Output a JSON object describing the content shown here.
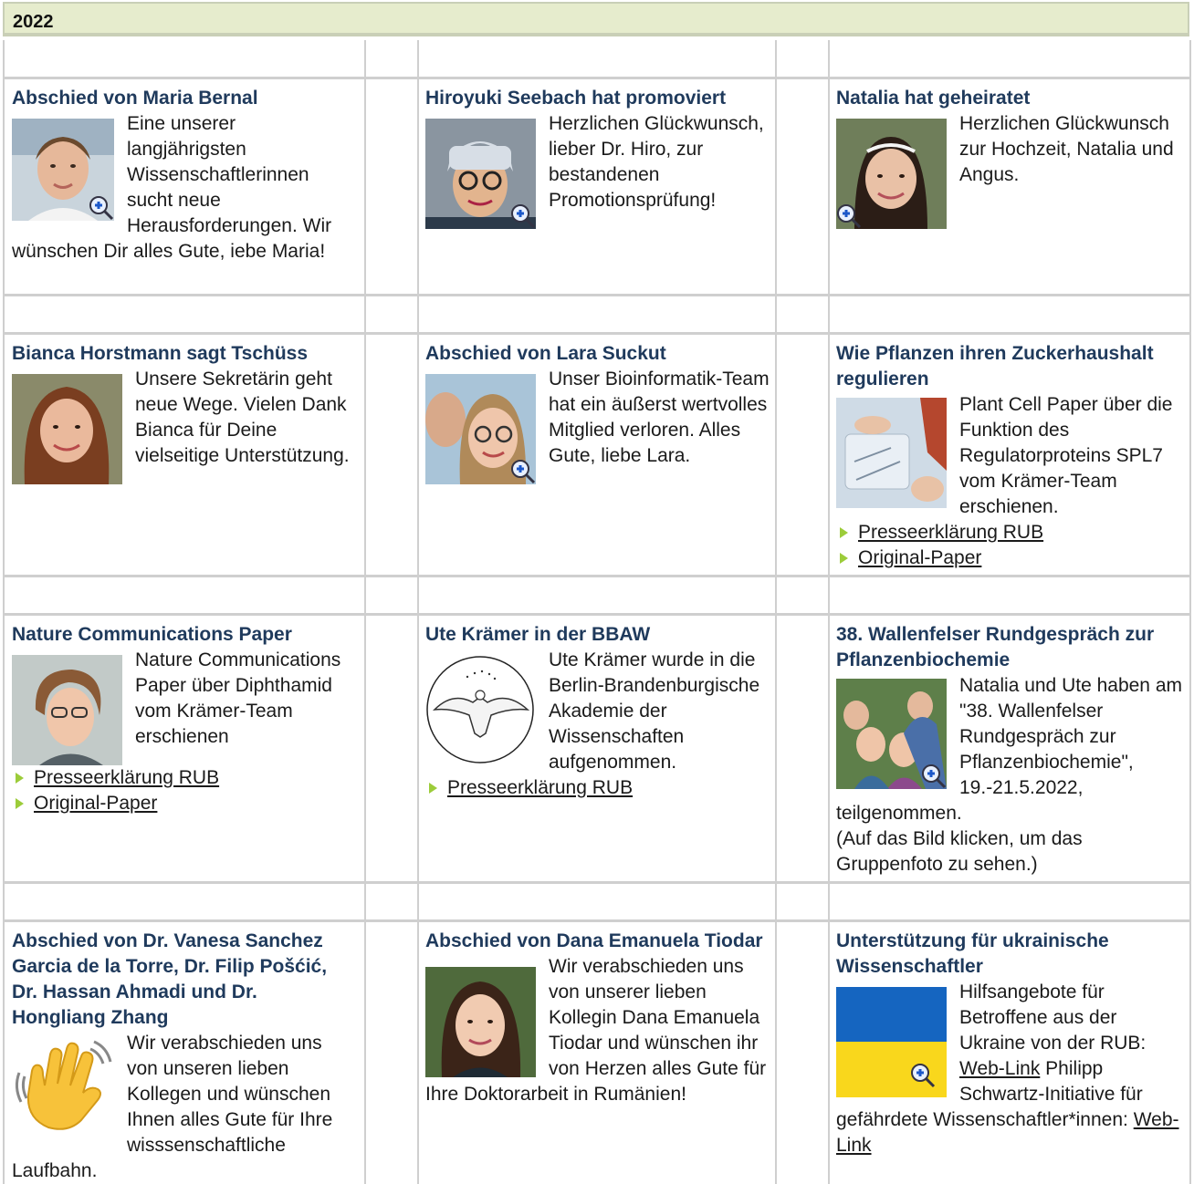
{
  "year": "2022",
  "news": [
    {
      "title": "Abschied von Maria Bernal",
      "text": "Eine unserer langjährigsten Wissenschaftlerinnen sucht neue Herausforderungen. Wir wünschen Dir alles Gute, iebe Maria!",
      "image": "portrait-woman-icon",
      "zoomable": true
    },
    {
      "title": "Hiroyuki Seebach hat promoviert",
      "text": "Herzlichen Glückwunsch, lieber Dr. Hiro, zur bestandenen Promotionsprüfung!",
      "image": "portrait-man-hat-icon",
      "zoomable": true
    },
    {
      "title": "Natalia hat geheiratet",
      "text": "Herzlichen Glückwunsch zur Hochzeit, Natalia und Angus.",
      "image": "portrait-bride-icon",
      "zoomable": true
    },
    {
      "title": "Bianca Horstmann sagt Tschüss",
      "text": "Unsere Sekretärin geht neue Wege. Vielen Dank Bianca für Deine vielseitige Unterstützung.",
      "image": "portrait-woman-icon",
      "zoomable": false
    },
    {
      "title": "Abschied von Lara Suckut",
      "text": "Unser Bioinformatik-Team hat ein äußerst wertvolles Mitglied verloren. Alles Gute, liebe Lara.",
      "image": "portrait-couple-icon",
      "zoomable": true
    },
    {
      "title": "Wie Pflanzen ihren Zuckerhaushalt regulieren",
      "text": "Plant Cell Paper über die Funktion des Regulatorproteins SPL7 vom Krämer-Team erschienen.",
      "image": "lab-photo-icon",
      "zoomable": false,
      "links": [
        "Presseerklärung RUB",
        "Original-Paper"
      ]
    },
    {
      "title": "Nature Communications Paper",
      "text": "Nature Communications Paper über Diphthamid vom Krämer-Team erschienen",
      "image": "portrait-woman-icon",
      "zoomable": false,
      "links": [
        "Presseerklärung RUB",
        "Original-Paper"
      ]
    },
    {
      "title": "Ute Krämer in der BBAW",
      "text": "Ute Krämer wurde in die Berlin-Brandenburgische Akademie der Wissenschaften aufgenommen.",
      "image": "eagle-seal-icon",
      "zoomable": false,
      "links": [
        "Presseerklärung RUB"
      ]
    },
    {
      "title": "38. Wallenfelser Rundgespräch zur Pflanzenbiochemie",
      "text": "Natalia und Ute haben am \"38. Wallenfelser Rundgespräch zur Pflanzenbiochemie\", 19.-21.5.2022, teilgenommen.",
      "note": "(Auf das Bild klicken, um das Gruppenfoto zu sehen.)",
      "image": "group-photo-icon",
      "zoomable": true
    },
    {
      "title": "Abschied von Dr. Vanesa Sanchez Garcia de la Torre, Dr. Filip Pošćić, Dr. Hassan Ahmadi und Dr. Hongliang Zhang",
      "text": "Wir verabschieden uns von unseren lieben Kollegen und wünschen Ihnen alles Gute für Ihre wisssenschaftliche Laufbahn.",
      "image": "waving-hand-icon",
      "zoomable": false
    },
    {
      "title": "Abschied von Dana Emanuela Tiodar",
      "text": "Wir verabschieden uns von unserer lieben Kollegin Dana Emanuela Tiodar und wünschen ihr von Herzen alles Gute für Ihre Doktorarbeit in Rumänien!",
      "image": "portrait-woman-icon",
      "zoomable": false
    },
    {
      "title": "Unterstützung für ukrainische Wissenschaftler",
      "text1": "Hilfsangebote für Betroffene aus der Ukraine von der RUB:",
      "link1": "Web-Link",
      "text2": "Philipp Schwartz-Initiative für gefährdete Wissenschaftler*innen:",
      "link2": "Web-Link",
      "image": "ukraine-flag-icon",
      "zoomable": true
    }
  ],
  "colors": {
    "header_bg": "#e6eccd",
    "title": "#1f3a5c",
    "bullet": "#9ccc3a",
    "grid": "#cfcfcf",
    "flag_blue": "#1565c0",
    "flag_yellow": "#f9d71c"
  }
}
